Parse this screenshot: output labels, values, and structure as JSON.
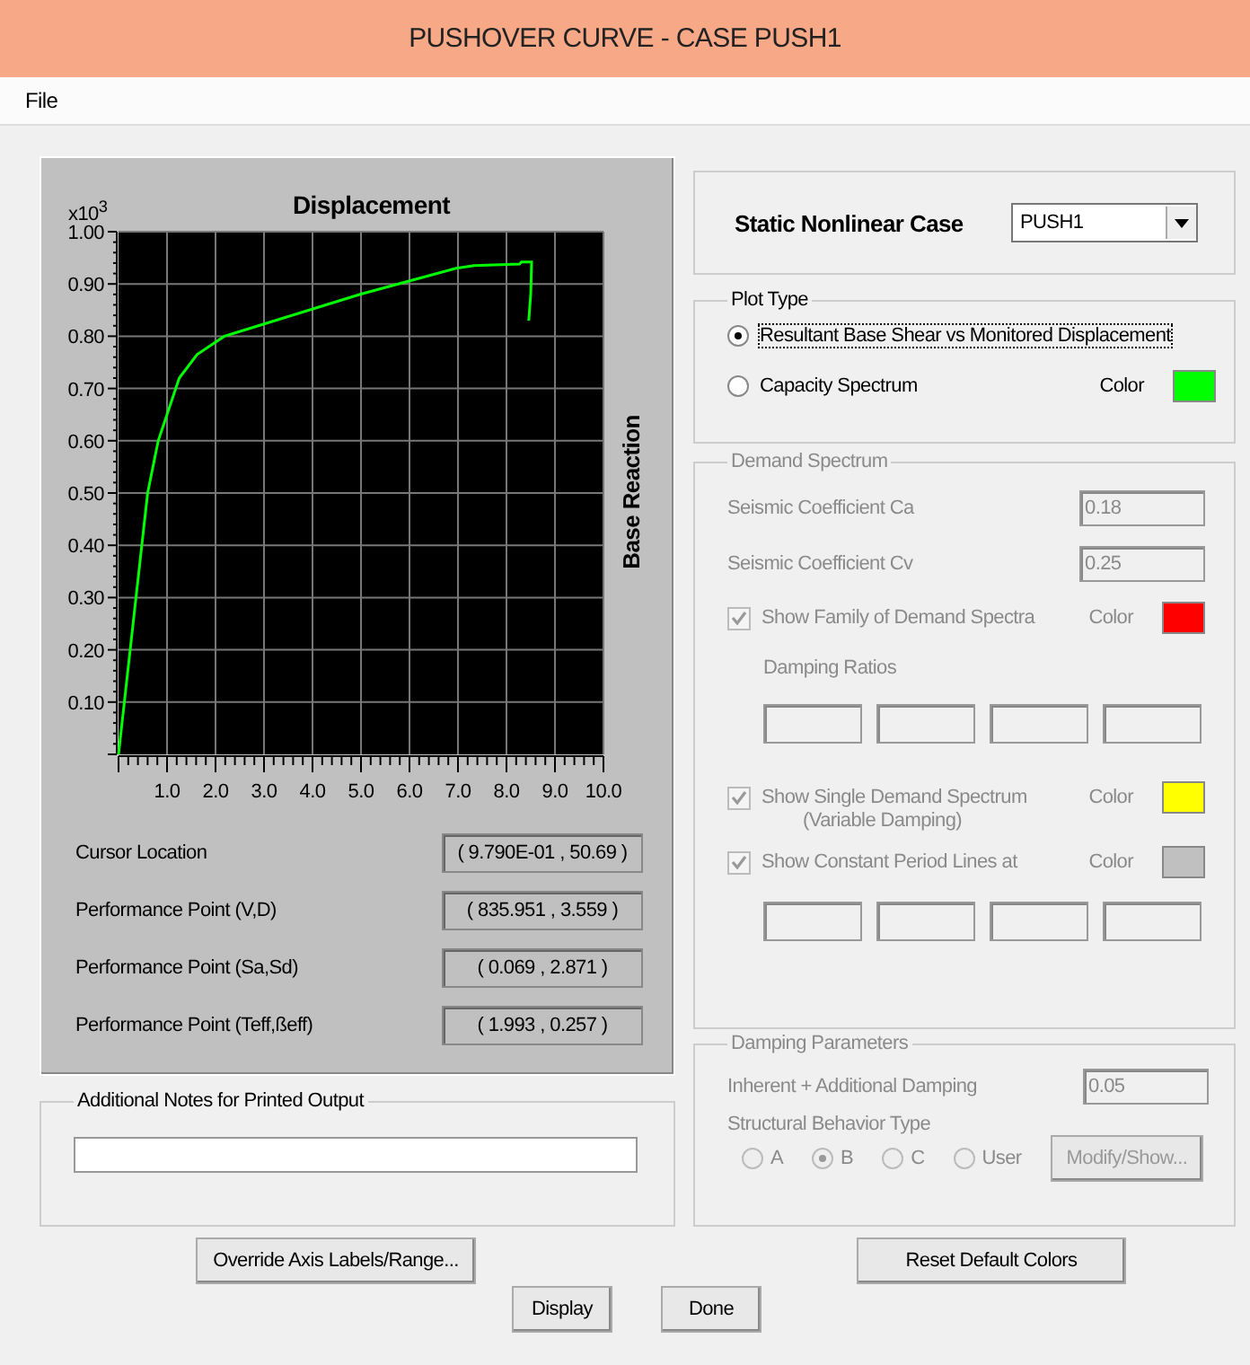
{
  "window": {
    "title": "PUSHOVER CURVE - CASE PUSH1"
  },
  "menu": [
    {
      "label": "File"
    }
  ],
  "plot_panel": {
    "scale_label": "x10$^{3}$",
    "chart_data": {
      "type": "line",
      "grid": true,
      "title": "Displacement",
      "ylabel": "Base Reaction",
      "xlim": [
        0,
        10
      ],
      "ylim": [
        0,
        1
      ],
      "xticks": [
        {
          "value": 1,
          "label": "1.0"
        },
        {
          "value": 2,
          "label": "2.0"
        },
        {
          "value": 3,
          "label": "3.0"
        },
        {
          "value": 4,
          "label": "4.0"
        },
        {
          "value": 5,
          "label": "5.0"
        },
        {
          "value": 6,
          "label": "6.0"
        },
        {
          "value": 7,
          "label": "7.0"
        },
        {
          "value": 8,
          "label": "8.0"
        },
        {
          "value": 9,
          "label": "9.0"
        },
        {
          "value": 10,
          "label": "10.0"
        }
      ],
      "yticks": [
        {
          "value": 0.1,
          "label": "0.10"
        },
        {
          "value": 0.2,
          "label": "0.20"
        },
        {
          "value": 0.3,
          "label": "0.30"
        },
        {
          "value": 0.4,
          "label": "0.40"
        },
        {
          "value": 0.5,
          "label": "0.50"
        },
        {
          "value": 0.6,
          "label": "0.60"
        },
        {
          "value": 0.7,
          "label": "0.70"
        },
        {
          "value": 0.8,
          "label": "0.80"
        },
        {
          "value": 0.9,
          "label": "0.90"
        },
        {
          "value": 1,
          "label": "1.00"
        }
      ],
      "x": [
        0,
        0.6,
        0.82,
        1.25,
        1.62,
        2.18,
        4.98,
        5.97,
        6.96,
        7.33,
        8.27,
        8.31,
        8.52,
        8.5,
        8.46
      ],
      "series": [
        {
          "color": "#00ff00",
          "values": [
            0,
            0.5,
            0.6,
            0.72,
            0.765,
            0.8,
            0.88,
            0.905,
            0.93,
            0.935,
            0.938,
            0.942,
            0.942,
            0.88,
            0.83
          ]
        }
      ]
    },
    "readouts": [
      {
        "label": "Cursor Location",
        "value": "( 9.790E-01 , 50.69 )"
      },
      {
        "label": "Performance Point (V,D)",
        "value": "( 835.951 , 3.559 )"
      },
      {
        "label": "Performance Point (Sa,Sd)",
        "value": "( 0.069 , 2.871 )"
      },
      {
        "label": "Performance Point (Teff,ßeff)",
        "value": "( 1.993 , 0.257 )"
      }
    ]
  },
  "notes": {
    "title": "Additional Notes for Printed Output"
  },
  "case": {
    "label": "Static Nonlinear Case",
    "value": "PUSH1"
  },
  "plot_type": {
    "title": "Plot Type",
    "options": [
      {
        "label": "Resultant Base Shear vs Monitored Displacement",
        "selected": true
      },
      {
        "label": "Capacity Spectrum",
        "selected": false
      }
    ],
    "color_label": "Color",
    "color": "#00ff00"
  },
  "demand_spectrum": {
    "title": "Demand Spectrum",
    "disabled": true,
    "fields": [
      {
        "label": "Seismic Coefficient  Ca",
        "value": "0.18"
      },
      {
        "label": "Seismic Coefficient  Cv",
        "value": "0.25"
      }
    ],
    "family": {
      "label": "Show Family of Demand Spectra",
      "checked": true,
      "color_label": "Color",
      "color": "#ff0000"
    },
    "damping_ratios_label": "Damping Ratios",
    "damping_ratio_boxes": [
      {
        "disabled": true
      },
      {
        "disabled": true
      },
      {
        "disabled": true
      },
      {
        "disabled": true
      }
    ],
    "single": {
      "label": "Show Single  Demand Spectrum",
      "sublabel": "(Variable Damping)",
      "checked": true,
      "color_label": "Color",
      "color": "#ffff00"
    },
    "period_lines": {
      "label": "Show Constant Period Lines at",
      "checked": true,
      "color_label": "Color",
      "color": "#c0c0c0"
    },
    "period_boxes": [
      {
        "disabled": true
      },
      {
        "disabled": true
      },
      {
        "disabled": true
      },
      {
        "disabled": true
      }
    ]
  },
  "damping": {
    "title": "Damping Parameters",
    "disabled": true,
    "field": {
      "label": "Inherent + Additional Damping",
      "value": "0.05"
    },
    "behavior_label": "Structural Behavior Type",
    "options": [
      {
        "label": "A",
        "selected": false
      },
      {
        "label": "B",
        "selected": true
      },
      {
        "label": "C",
        "selected": false
      },
      {
        "label": "User",
        "selected": false
      }
    ],
    "button": "Modify/Show..."
  },
  "buttons": [
    {
      "label": "Override Axis Labels/Range..."
    },
    {
      "label": "Reset Default Colors"
    },
    {
      "label": "Display"
    },
    {
      "label": "Done"
    }
  ]
}
